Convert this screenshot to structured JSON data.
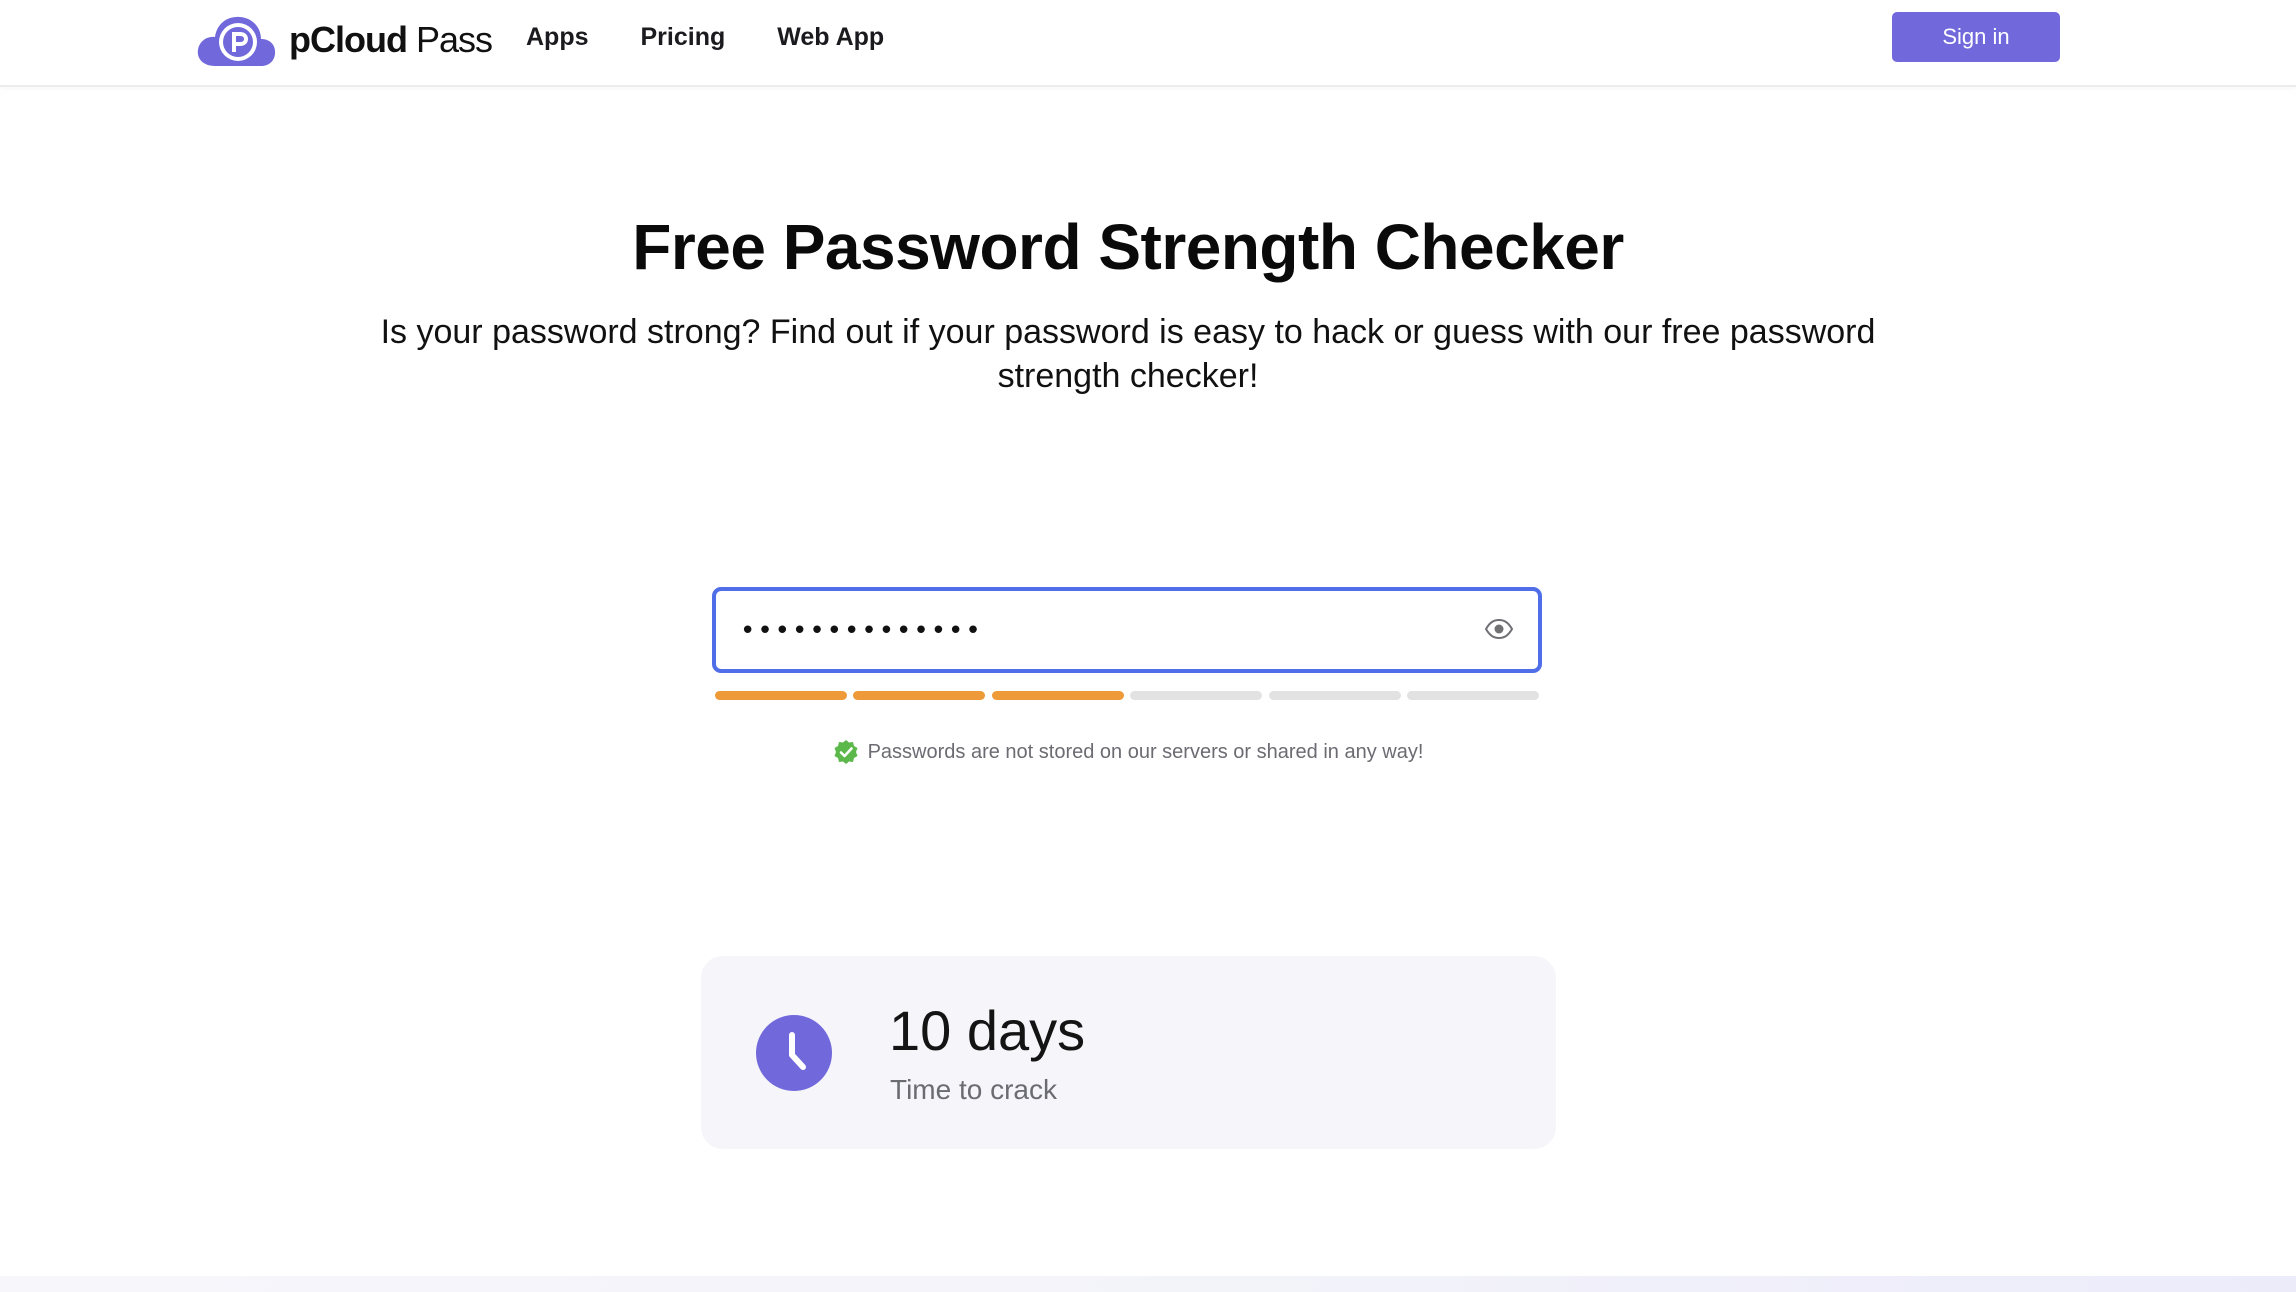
{
  "header": {
    "brand": "pCloud",
    "product": "Pass",
    "nav": [
      {
        "label": "Apps"
      },
      {
        "label": "Pricing"
      },
      {
        "label": "Web App"
      }
    ],
    "signin_label": "Sign in"
  },
  "hero": {
    "title": "Free Password Strength Checker",
    "subtitle": "Is your password strong? Find out if your password is easy to hack or guess with our free password strength checker!"
  },
  "password": {
    "value": "••••••••••••••",
    "strength_segments_total": 6,
    "strength_segments_filled": 3
  },
  "notice": {
    "text": "Passwords are not stored on our servers or shared in any way!"
  },
  "result": {
    "value": "10 days",
    "label": "Time to crack"
  },
  "colors": {
    "accent": "#7169db",
    "input_focus": "#4f6ee8",
    "strength_on": "#ef9a38",
    "strength_off": "#e2e2e2",
    "check": "#5cb84a"
  },
  "icons": {
    "logo": "pcloud-cloud-p-logo",
    "eye": "eye-icon",
    "check": "verified-check-icon",
    "clock": "clock-icon"
  }
}
